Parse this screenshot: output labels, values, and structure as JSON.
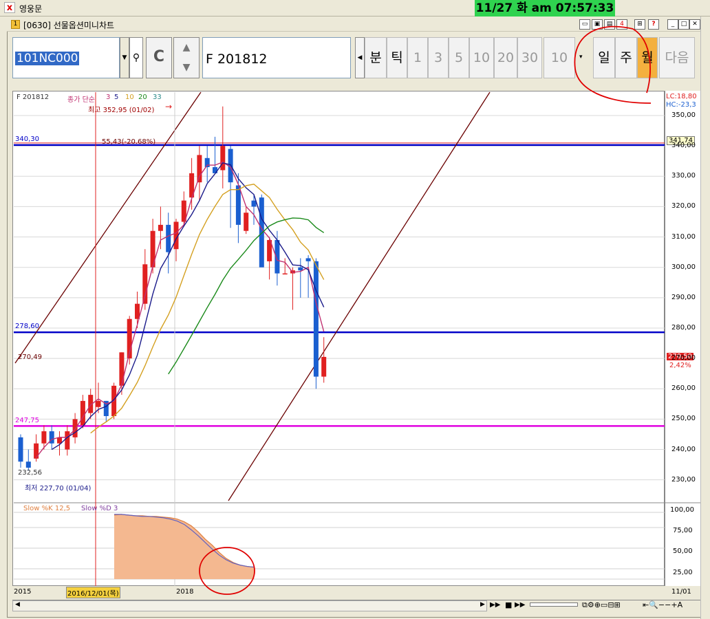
{
  "app": {
    "title": "영웅문",
    "logo_char": "x"
  },
  "clock": "11/27 화 am 07:57:33",
  "window": {
    "title": "[0630] 선물옵션미니차트",
    "icon": "window-icon",
    "buttons": [
      "sub-window-icon",
      "restore-icon",
      "print-icon",
      "number-4-icon",
      "grid-icon",
      "help-icon",
      "minimize-icon",
      "maximize-icon",
      "close-icon"
    ]
  },
  "toolbar": {
    "code_value": "101NC000",
    "search_icon": "search-icon",
    "c_label": "C",
    "month_value": "F  201812",
    "periods": [
      "분",
      "틱",
      "1",
      "3",
      "5",
      "10",
      "20",
      "30"
    ],
    "period_count": "10",
    "period_types": [
      "일",
      "주",
      "월"
    ],
    "active_period": "월",
    "next_label": "다음"
  },
  "chart_header": {
    "series_name": "F 201812",
    "ma_label": "종가 단순",
    "ma_periods": [
      "3",
      "5",
      "10",
      "20",
      "33"
    ],
    "max_label": "최고 352,95 (01/02)",
    "min_label": "최저 227,70 (01/04)",
    "measure_label": "55,43(-20.68%)"
  },
  "right_info": {
    "lc": "LC:18,80",
    "hc": "HC:-23,3",
    "current_price": "341,74",
    "last_price": "270,50",
    "change_pct": "2,42%"
  },
  "hlines": [
    {
      "label": "340,30",
      "value": 340.3,
      "color": "#0000c8"
    },
    {
      "label": "278,60",
      "value": 278.6,
      "color": "#0000c8"
    },
    {
      "label": "247,75",
      "value": 247.75,
      "color": "#e000e0"
    }
  ],
  "price_labels": {
    "left_270": "270,49",
    "left_232": "232,56"
  },
  "x_labels": {
    "year_2015": "2015",
    "cursor_date": "2016/12/01(목)",
    "year_2018": "2018",
    "last_date": "11/01"
  },
  "stoch": {
    "label_k": "Slow %K 12,5",
    "label_d": "Slow %D 3",
    "ticks": [
      "100,00",
      "75,00",
      "50,00",
      "25,00"
    ]
  },
  "colors": {
    "up": "#e02020",
    "down": "#1a5fd0",
    "ma3": "#c03070",
    "ma5": "#1a1a8a",
    "ma10": "#d4a020",
    "ma20": "#1a8a1a",
    "trendline": "#6a0000"
  },
  "chart_data": {
    "type": "candlestick",
    "title": "F 201812",
    "ylabel": "",
    "ylim": [
      220,
      355
    ],
    "yticks": [
      230,
      240,
      250,
      260,
      270,
      280,
      290,
      300,
      310,
      320,
      330,
      340,
      350
    ],
    "candles": [
      [
        244,
        245,
        234,
        236
      ],
      [
        236,
        240,
        233,
        234
      ],
      [
        237,
        245,
        236,
        242
      ],
      [
        242,
        248,
        240,
        246
      ],
      [
        246,
        248,
        240,
        242
      ],
      [
        242,
        246,
        238,
        244
      ],
      [
        240,
        248,
        238,
        246
      ],
      [
        244,
        252,
        242,
        250
      ],
      [
        248,
        258,
        247,
        256
      ],
      [
        252,
        260,
        250,
        258
      ],
      [
        254,
        262,
        252,
        256
      ],
      [
        256,
        256,
        249,
        251
      ],
      [
        251,
        262,
        250,
        261
      ],
      [
        261,
        272,
        258,
        272
      ],
      [
        270,
        284,
        268,
        283
      ],
      [
        283,
        292,
        280,
        288
      ],
      [
        288,
        306,
        286,
        301
      ],
      [
        300,
        316,
        298,
        312
      ],
      [
        312,
        320,
        306,
        314
      ],
      [
        314,
        318,
        298,
        305
      ],
      [
        306,
        316,
        302,
        315
      ],
      [
        315,
        325,
        314,
        322
      ],
      [
        323,
        336,
        319,
        331
      ],
      [
        328,
        340,
        322,
        337
      ],
      [
        336,
        340,
        328,
        333
      ],
      [
        333,
        343,
        331,
        331
      ],
      [
        332,
        353,
        326,
        340
      ],
      [
        339,
        340,
        313,
        328
      ],
      [
        327,
        331,
        308,
        314
      ],
      [
        312,
        320,
        311,
        318
      ],
      [
        322,
        324,
        314,
        320
      ],
      [
        323,
        324,
        303,
        300
      ],
      [
        302,
        310,
        296,
        309
      ],
      [
        309,
        312,
        294,
        298
      ],
      [
        298,
        303,
        298,
        298
      ],
      [
        298,
        300,
        286,
        299
      ],
      [
        300,
        303,
        290,
        299
      ],
      [
        303,
        304,
        290,
        302
      ],
      [
        302,
        303,
        260,
        264
      ],
      [
        264,
        277,
        262,
        270.5
      ]
    ],
    "stoch_k": [
      96,
      97,
      96,
      95,
      95,
      94,
      94,
      93,
      92,
      90,
      86,
      80,
      71,
      60,
      51,
      40,
      31,
      25,
      21,
      19,
      18
    ],
    "stoch_d": [
      97,
      97,
      96,
      95,
      94,
      94,
      93,
      92,
      90,
      87,
      82,
      74,
      65,
      55,
      45,
      36,
      29,
      24,
      21,
      19,
      18
    ]
  }
}
